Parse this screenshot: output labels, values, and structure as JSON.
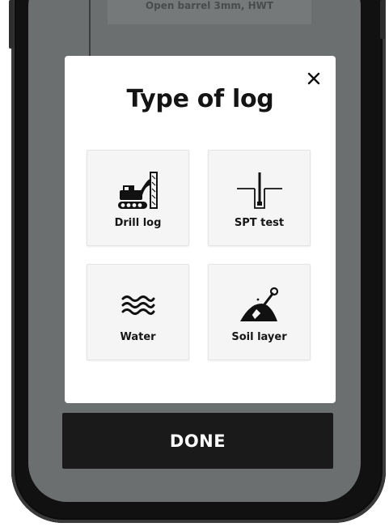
{
  "background": {
    "card_text": "Open barrel 3mm, HWT"
  },
  "modal": {
    "title": "Type of log",
    "close_icon": "close-icon",
    "options": [
      {
        "label": "Drill log",
        "icon": "drill-rig-icon"
      },
      {
        "label": "SPT test",
        "icon": "spt-test-icon"
      },
      {
        "label": "Water",
        "icon": "water-waves-icon"
      },
      {
        "label": "Soil layer",
        "icon": "soil-shovel-icon"
      }
    ]
  },
  "done_button": {
    "label": "DONE"
  },
  "colors": {
    "screen_background": "#6b6f70",
    "modal_background": "#ffffff",
    "tile_background": "#f5f5f5",
    "primary_button": "#1a1a1a",
    "text": "#141414"
  }
}
